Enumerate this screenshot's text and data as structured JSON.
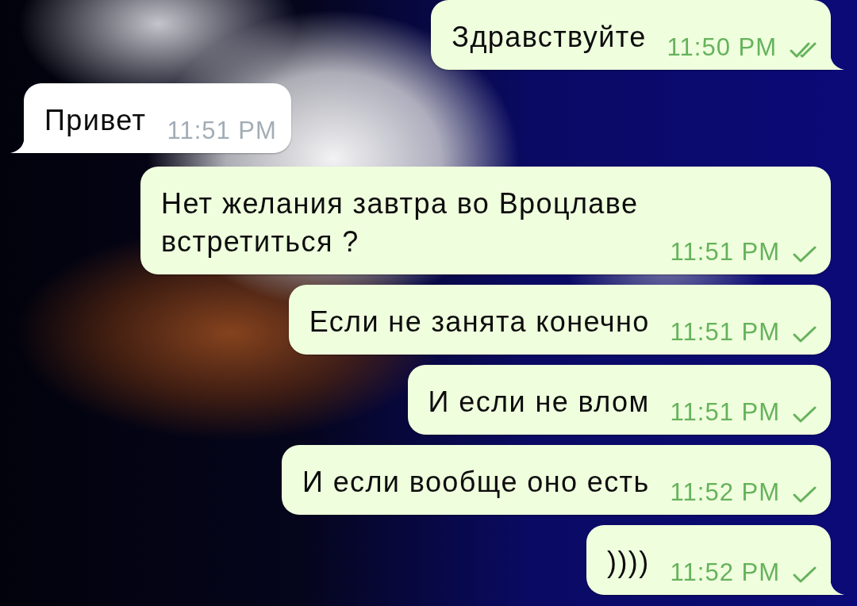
{
  "messages": [
    {
      "kind": "outgoing",
      "text": "Здравствуйте",
      "time": "11:50 PM",
      "read": true,
      "tail": true
    },
    {
      "kind": "incoming",
      "text": "Привет",
      "time": "11:51 PM",
      "tail": true
    },
    {
      "kind": "outgoing",
      "text": "Нет желания завтра во Вроцлаве встретиться ?",
      "time": "11:51 PM",
      "read": false,
      "tail": false
    },
    {
      "kind": "outgoing",
      "text": "Если не занята конечно",
      "time": "11:51 PM",
      "read": false,
      "tail": false
    },
    {
      "kind": "outgoing",
      "text": "И если не влом",
      "time": "11:51 PM",
      "read": false,
      "tail": false
    },
    {
      "kind": "outgoing",
      "text": "И если вообще оно есть",
      "time": "11:52 PM",
      "read": false,
      "tail": false
    },
    {
      "kind": "outgoing",
      "text": "))))",
      "time": "11:52 PM",
      "read": false,
      "tail": true
    }
  ]
}
